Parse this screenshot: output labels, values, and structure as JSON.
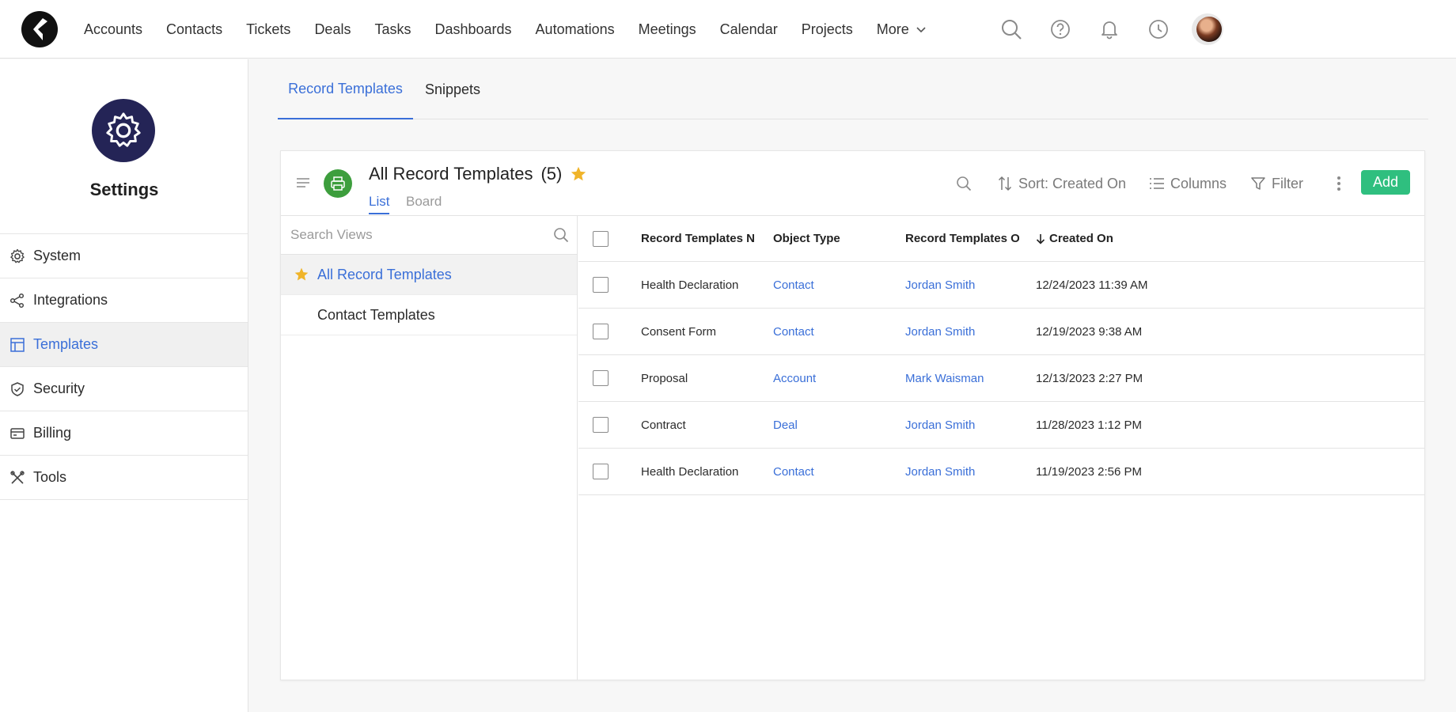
{
  "nav": {
    "items": [
      "Accounts",
      "Contacts",
      "Tickets",
      "Deals",
      "Tasks",
      "Dashboards",
      "Automations",
      "Meetings",
      "Calendar",
      "Projects"
    ],
    "more_label": "More"
  },
  "sidebar": {
    "title": "Settings",
    "items": [
      {
        "label": "System",
        "icon": "gear-icon"
      },
      {
        "label": "Integrations",
        "icon": "share-icon"
      },
      {
        "label": "Templates",
        "icon": "template-icon"
      },
      {
        "label": "Security",
        "icon": "shield-icon"
      },
      {
        "label": "Billing",
        "icon": "credit-card-icon"
      },
      {
        "label": "Tools",
        "icon": "tools-icon"
      }
    ]
  },
  "page_tabs": [
    "Record Templates",
    "Snippets"
  ],
  "view": {
    "title": "All Record Templates",
    "count": "(5)",
    "tabs": [
      "List",
      "Board"
    ]
  },
  "toolbar": {
    "sort_label": "Sort: Created On",
    "columns_label": "Columns",
    "filter_label": "Filter",
    "add_label": "Add"
  },
  "views_panel": {
    "search_placeholder": "Search Views",
    "items": [
      "All Record Templates",
      "Contact Templates"
    ]
  },
  "table": {
    "headers": [
      "Record Templates N",
      "Object Type",
      "Record Templates O",
      "Created On"
    ],
    "rows": [
      {
        "name": "Health Declaration",
        "type": "Contact",
        "owner": "Jordan Smith",
        "created": "12/24/2023 11:39 AM"
      },
      {
        "name": "Consent Form",
        "type": "Contact",
        "owner": "Jordan Smith",
        "created": "12/19/2023 9:38 AM"
      },
      {
        "name": "Proposal",
        "type": "Account",
        "owner": "Mark Waisman",
        "created": "12/13/2023 2:27 PM"
      },
      {
        "name": "Contract",
        "type": "Deal",
        "owner": "Jordan Smith",
        "created": "11/28/2023 1:12 PM"
      },
      {
        "name": "Health Declaration",
        "type": "Contact",
        "owner": "Jordan Smith",
        "created": "11/19/2023 2:56 PM"
      }
    ]
  },
  "colors": {
    "accent": "#3a6fd8",
    "add_button": "#2fbf7f",
    "settings_circle": "#242456",
    "print_circle": "#3d9e3d",
    "star": "#f0b429"
  }
}
